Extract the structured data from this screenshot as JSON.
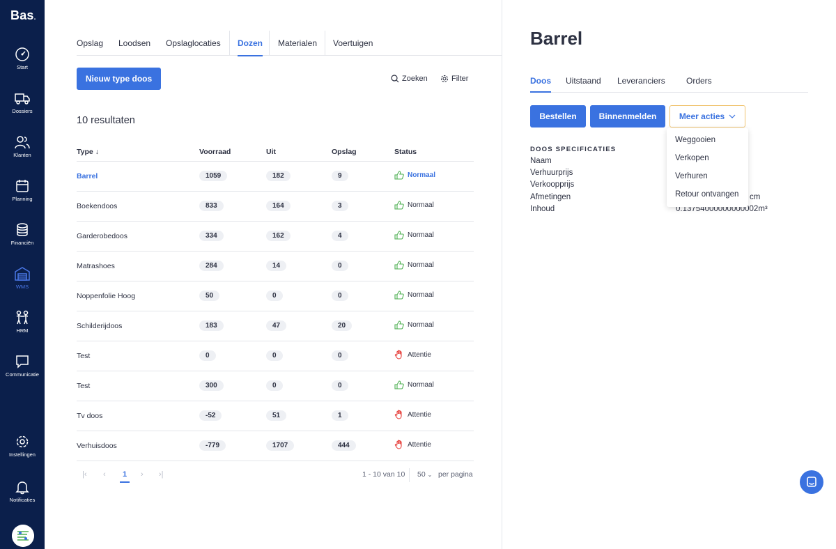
{
  "brand": {
    "name": "Bas"
  },
  "sidebar": {
    "items": [
      {
        "label": "Start",
        "icon": "dashboard-icon"
      },
      {
        "label": "Dossiers",
        "icon": "truck-icon"
      },
      {
        "label": "Klanten",
        "icon": "users-icon"
      },
      {
        "label": "Planning",
        "icon": "calendar-icon"
      },
      {
        "label": "Financiën",
        "icon": "coins-icon"
      },
      {
        "label": "WMS",
        "icon": "warehouse-icon",
        "active": true
      },
      {
        "label": "HRM",
        "icon": "people-icon"
      },
      {
        "label": "Communicatie",
        "icon": "chat-icon"
      },
      {
        "label": "Instellingen",
        "icon": "gear-icon"
      },
      {
        "label": "Notificaties",
        "icon": "bell-icon"
      }
    ]
  },
  "left": {
    "tabs": [
      {
        "label": "Opslag"
      },
      {
        "label": "Loodsen"
      },
      {
        "label": "Opslaglocaties"
      },
      {
        "label": "Dozen",
        "active": true
      },
      {
        "label": "Materialen"
      },
      {
        "label": "Voertuigen"
      }
    ],
    "new_button": "Nieuw type doos",
    "search_label": "Zoeken",
    "filter_label": "Filter",
    "results_text": "10 resultaten",
    "columns": [
      "Type",
      "Voorraad",
      "Uit",
      "Opslag",
      "Status"
    ],
    "rows": [
      {
        "type": "Barrel",
        "voorraad": "1059",
        "uit": "182",
        "opslag": "9",
        "status": "Normaal",
        "status_kind": "ok",
        "selected": true
      },
      {
        "type": "Boekendoos",
        "voorraad": "833",
        "uit": "164",
        "opslag": "3",
        "status": "Normaal",
        "status_kind": "ok"
      },
      {
        "type": "Garderobedoos",
        "voorraad": "334",
        "uit": "162",
        "opslag": "4",
        "status": "Normaal",
        "status_kind": "ok"
      },
      {
        "type": "Matrashoes",
        "voorraad": "284",
        "uit": "14",
        "opslag": "0",
        "status": "Normaal",
        "status_kind": "ok"
      },
      {
        "type": "Noppenfolie Hoog",
        "voorraad": "50",
        "uit": "0",
        "opslag": "0",
        "status": "Normaal",
        "status_kind": "ok"
      },
      {
        "type": "Schilderijdoos",
        "voorraad": "183",
        "uit": "47",
        "opslag": "20",
        "status": "Normaal",
        "status_kind": "ok"
      },
      {
        "type": "Test",
        "voorraad": "0",
        "uit": "0",
        "opslag": "0",
        "status": "Attentie",
        "status_kind": "alert"
      },
      {
        "type": "Test",
        "voorraad": "300",
        "uit": "0",
        "opslag": "0",
        "status": "Normaal",
        "status_kind": "ok"
      },
      {
        "type": "Tv doos",
        "voorraad": "-52",
        "uit": "51",
        "opslag": "1",
        "status": "Attentie",
        "status_kind": "alert"
      },
      {
        "type": "Verhuisdoos",
        "voorraad": "-779",
        "uit": "1707",
        "opslag": "444",
        "status": "Attentie",
        "status_kind": "alert"
      }
    ],
    "pagination": {
      "current_page": "1",
      "range_text": "1 - 10 van 10",
      "per_page_value": "50",
      "per_page_label": "per pagina"
    }
  },
  "right": {
    "title": "Barrel",
    "tabs": [
      {
        "label": "Doos",
        "active": true
      },
      {
        "label": "Uitstaand"
      },
      {
        "label": "Leveranciers"
      },
      {
        "label": "Orders"
      }
    ],
    "order_button": "Bestellen",
    "checkin_button": "Binnenmelden",
    "more_button": "Meer acties",
    "spec_heading": "DOOS SPECIFICATIES",
    "specs": [
      {
        "label": "Naam",
        "value": ""
      },
      {
        "label": "Verhuurprijs",
        "value": ""
      },
      {
        "label": "Verkoopprijs",
        "value": ""
      },
      {
        "label": "Afmetingen",
        "value": "cm"
      },
      {
        "label": "Inhoud",
        "value": "0.13754000000000002m³"
      }
    ],
    "menu_items": [
      "Weggooien",
      "Verkopen",
      "Verhuren",
      "Retour ontvangen"
    ]
  },
  "colors": {
    "sidebar": "#0b1f4b",
    "accent": "#3a72e0",
    "ok": "#4caf50",
    "alert": "#e53935",
    "outline": "#f0c36d"
  }
}
